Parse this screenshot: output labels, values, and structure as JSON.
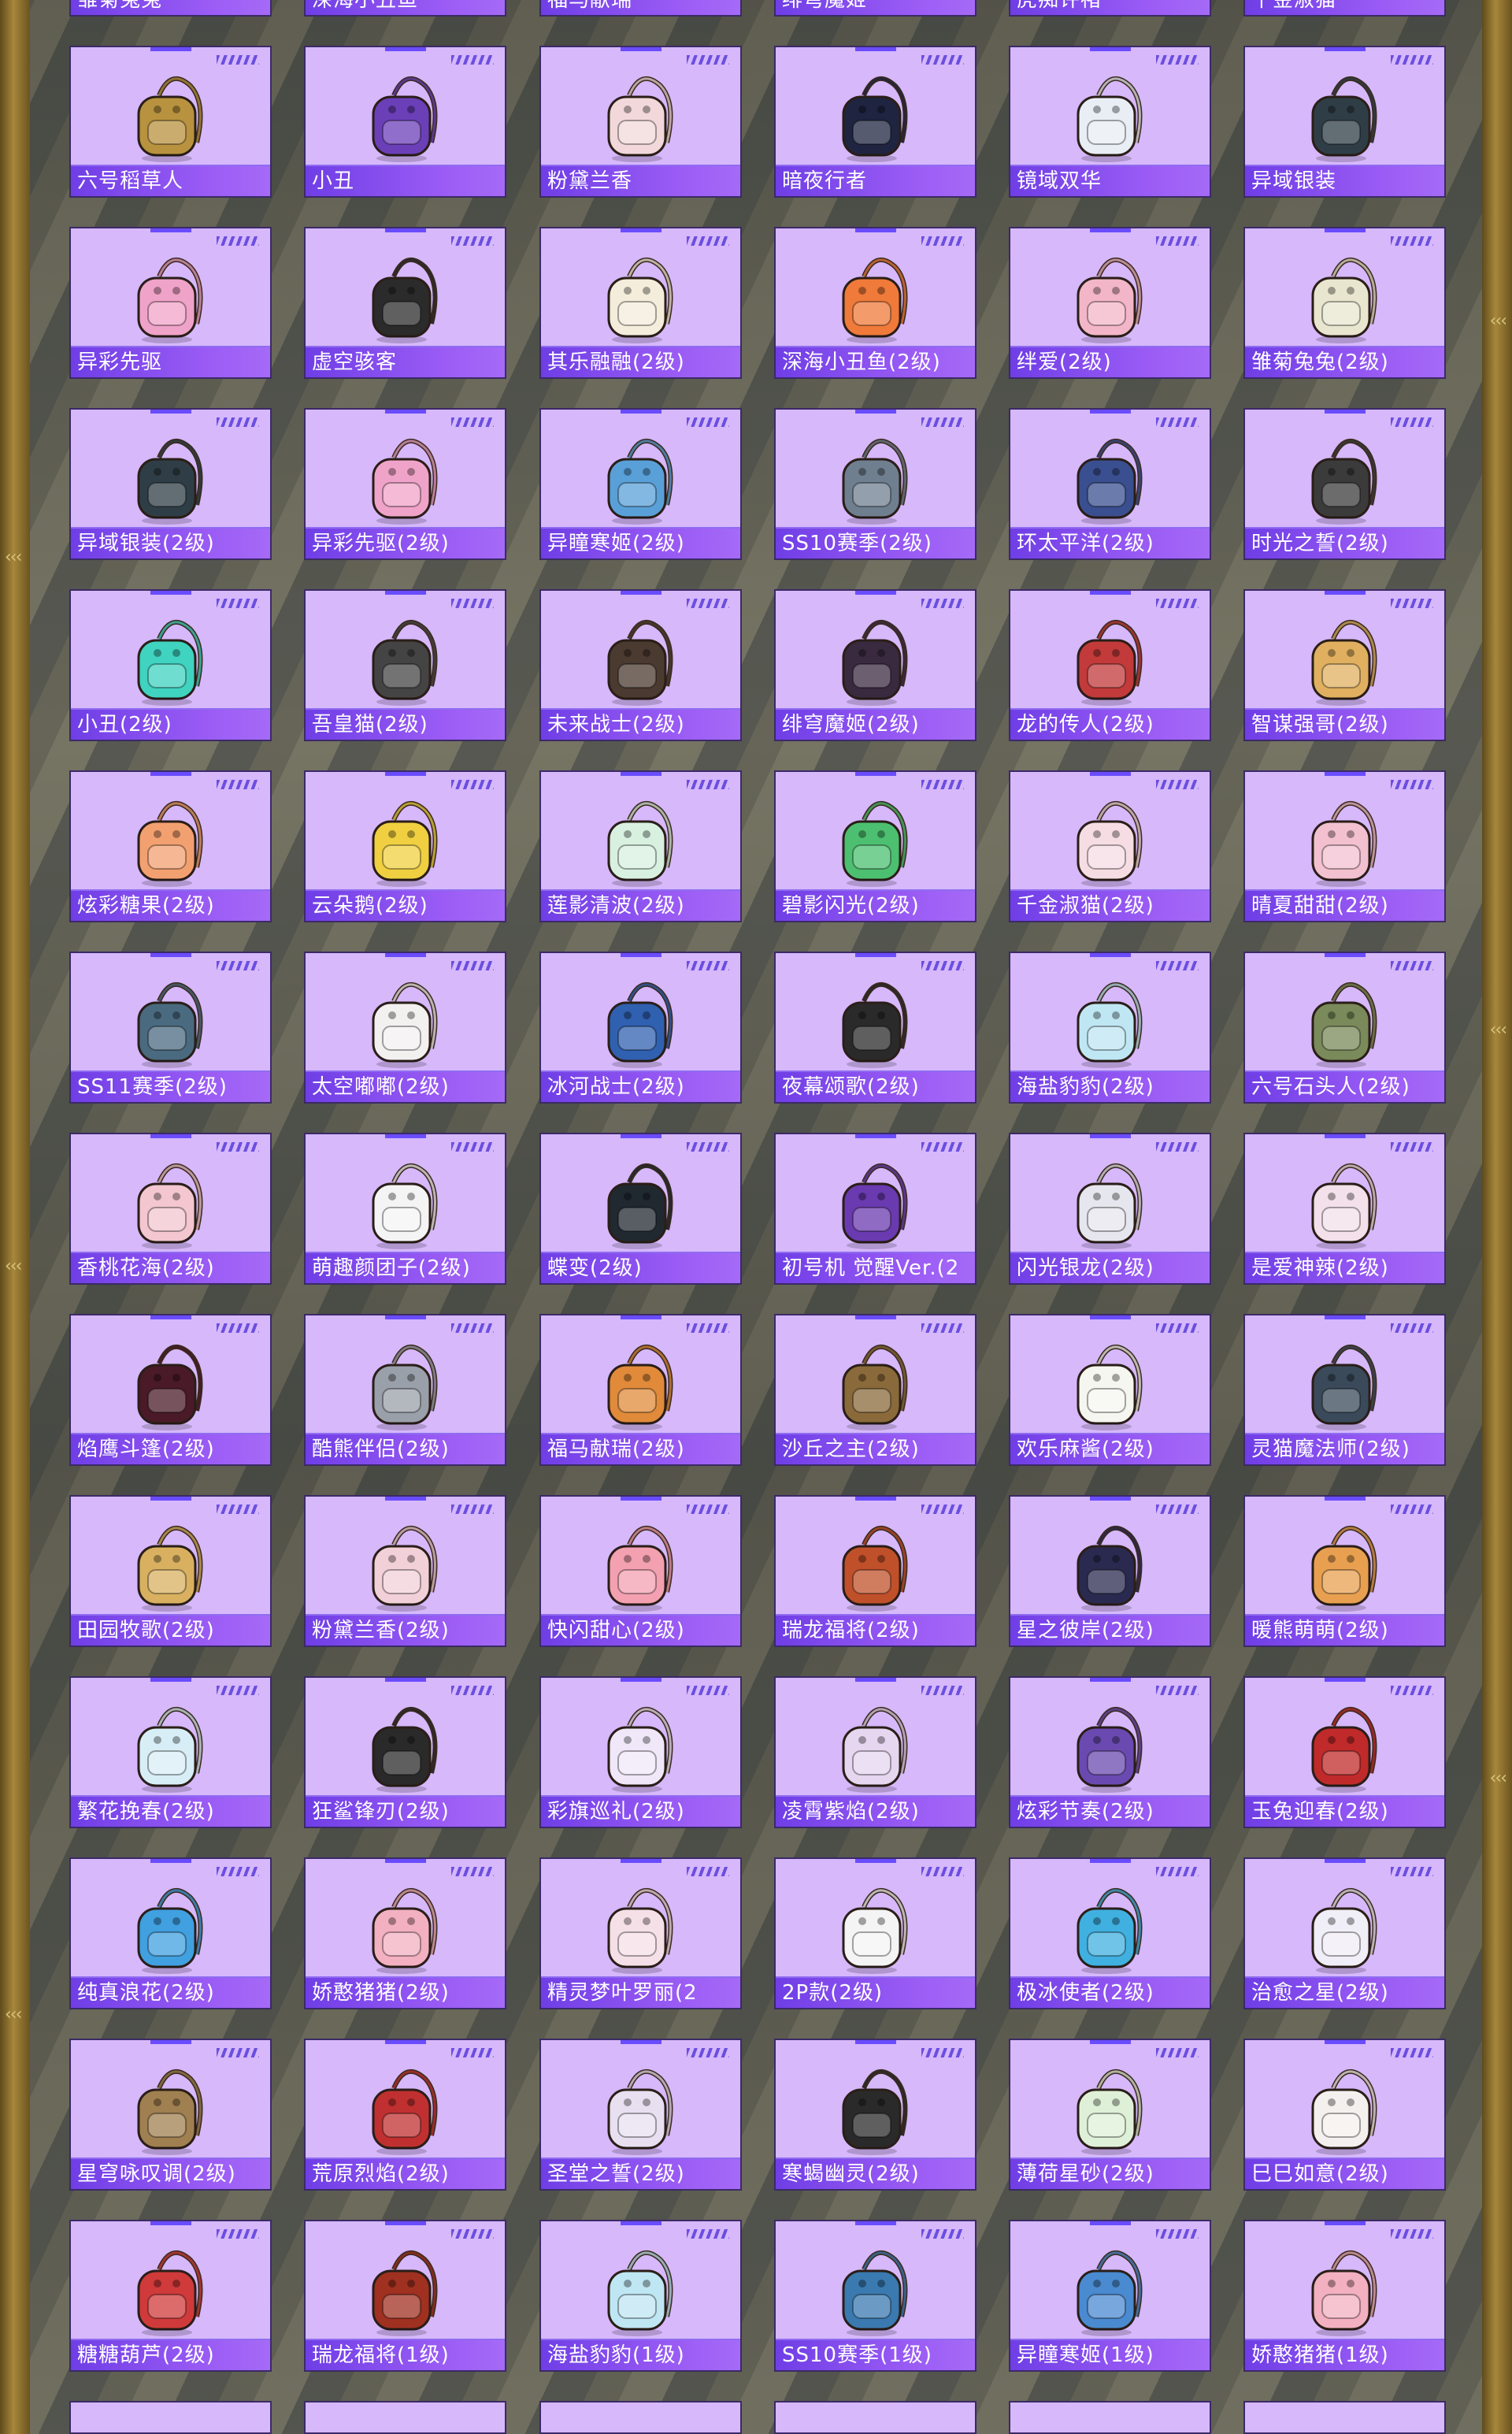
{
  "colors": {
    "card_bg": "#d6b8fb",
    "label_bar": "#7a44ec",
    "frame_gold": "#a7873a"
  },
  "rows": [
    {
      "items": [
        {
          "name": "雏菊兔兔",
          "icon": "backpack-icon",
          "color": "#e7d9b7"
        },
        {
          "name": "深海小丑鱼",
          "icon": "backpack-icon",
          "color": "#f07a3a"
        },
        {
          "name": "福马献瑞",
          "icon": "backpack-icon",
          "color": "#e08a4a"
        },
        {
          "name": "绯穹魔姬",
          "icon": "backpack-icon",
          "color": "#2a2a40"
        },
        {
          "name": "虎痴许褚",
          "icon": "backpack-icon",
          "color": "#c7a454"
        },
        {
          "name": "千金淑猫",
          "icon": "backpack-icon",
          "color": "#f4d3e0"
        }
      ]
    },
    {
      "items": [
        {
          "name": "六号稻草人",
          "icon": "backpack-icon",
          "color": "#b8923e"
        },
        {
          "name": "小丑",
          "icon": "backpack-icon",
          "color": "#6b3fb8"
        },
        {
          "name": "粉黛兰香",
          "icon": "backpack-icon",
          "color": "#f2d8da"
        },
        {
          "name": "暗夜行者",
          "icon": "backpack-icon",
          "color": "#1f2440"
        },
        {
          "name": "镜域双华",
          "icon": "backpack-icon",
          "color": "#e9eef5"
        },
        {
          "name": "异域银装",
          "icon": "backpack-icon",
          "color": "#2f3e46"
        }
      ]
    },
    {
      "items": [
        {
          "name": "异彩先驱",
          "icon": "backpack-icon",
          "color": "#f0a3c8"
        },
        {
          "name": "虚空骇客",
          "icon": "backpack-icon",
          "color": "#2b2b2b"
        },
        {
          "name": "其乐融融(2级)",
          "icon": "backpack-icon",
          "color": "#f5eddc"
        },
        {
          "name": "深海小丑鱼(2级)",
          "icon": "backpack-icon",
          "color": "#f07a3a"
        },
        {
          "name": "绊爱(2级)",
          "icon": "backpack-icon",
          "color": "#f3b6c8"
        },
        {
          "name": "雏菊兔兔(2级)",
          "icon": "backpack-icon",
          "color": "#e9e6cf"
        }
      ]
    },
    {
      "items": [
        {
          "name": "异域银装(2级)",
          "icon": "backpack-icon",
          "color": "#2f3e46"
        },
        {
          "name": "异彩先驱(2级)",
          "icon": "backpack-icon",
          "color": "#f0a3c8"
        },
        {
          "name": "异瞳寒姬(2级)",
          "icon": "backpack-icon",
          "color": "#5aa0d8"
        },
        {
          "name": "SS10赛季(2级)",
          "icon": "backpack-icon",
          "color": "#6f7f90"
        },
        {
          "name": "环太平洋(2级)",
          "icon": "backpack-icon",
          "color": "#3a4f90"
        },
        {
          "name": "时光之誓(2级)",
          "icon": "backpack-icon",
          "color": "#3b3b3b"
        }
      ]
    },
    {
      "items": [
        {
          "name": "小丑(2级)",
          "icon": "backpack-icon",
          "color": "#3fd3c0"
        },
        {
          "name": "吾皇猫(2级)",
          "icon": "backpack-icon",
          "color": "#444444"
        },
        {
          "name": "未来战士(2级)",
          "icon": "backpack-icon",
          "color": "#4a3a30"
        },
        {
          "name": "绯穹魔姬(2级)",
          "icon": "backpack-icon",
          "color": "#3a2a40"
        },
        {
          "name": "龙的传人(2级)",
          "icon": "backpack-icon",
          "color": "#c23a3a"
        },
        {
          "name": "智谋强哥(2级)",
          "icon": "backpack-icon",
          "color": "#e0b060"
        }
      ]
    },
    {
      "items": [
        {
          "name": "炫彩糖果(2级)",
          "icon": "backpack-icon",
          "color": "#f3a070"
        },
        {
          "name": "云朵鹅(2级)",
          "icon": "backpack-icon",
          "color": "#f0d040"
        },
        {
          "name": "莲影清波(2级)",
          "icon": "backpack-icon",
          "color": "#d8f0e0"
        },
        {
          "name": "碧影闪光(2级)",
          "icon": "backpack-icon",
          "color": "#4cc070"
        },
        {
          "name": "千金淑猫(2级)",
          "icon": "backpack-icon",
          "color": "#f6dde4"
        },
        {
          "name": "晴夏甜甜(2级)",
          "icon": "backpack-icon",
          "color": "#f3c0d0"
        }
      ]
    },
    {
      "items": [
        {
          "name": "SS11赛季(2级)",
          "icon": "backpack-icon",
          "color": "#4a6a80"
        },
        {
          "name": "太空嘟嘟(2级)",
          "icon": "backpack-icon",
          "color": "#f3f0f0"
        },
        {
          "name": "冰河战士(2级)",
          "icon": "backpack-icon",
          "color": "#3060b0"
        },
        {
          "name": "夜幕颂歌(2级)",
          "icon": "backpack-icon",
          "color": "#2a2a2a"
        },
        {
          "name": "海盐豹豹(2级)",
          "icon": "backpack-icon",
          "color": "#bfe6f3"
        },
        {
          "name": "六号石头人(2级)",
          "icon": "backpack-icon",
          "color": "#7a8a5a"
        }
      ]
    },
    {
      "items": [
        {
          "name": "香桃花海(2级)",
          "icon": "backpack-icon",
          "color": "#f3c6d0"
        },
        {
          "name": "萌趣颜团子(2级)",
          "icon": "backpack-icon",
          "color": "#f4f4f4"
        },
        {
          "name": "蝶变(2级)",
          "icon": "backpack-icon",
          "color": "#202830"
        },
        {
          "name": "初号机 觉醒Ver.(2",
          "icon": "backpack-icon",
          "color": "#6a3ab0"
        },
        {
          "name": "闪光银龙(2级)",
          "icon": "backpack-icon",
          "color": "#e6e6ee"
        },
        {
          "name": "是爱神辣(2级)",
          "icon": "backpack-icon",
          "color": "#f3e0ea"
        }
      ]
    },
    {
      "items": [
        {
          "name": "焰鹰斗篷(2级)",
          "icon": "backpack-icon",
          "color": "#4a1a28"
        },
        {
          "name": "酷熊伴侣(2级)",
          "icon": "backpack-icon",
          "color": "#9aa0aa"
        },
        {
          "name": "福马献瑞(2级)",
          "icon": "backpack-icon",
          "color": "#e08a3a"
        },
        {
          "name": "沙丘之主(2级)",
          "icon": "backpack-icon",
          "color": "#8a6a3a"
        },
        {
          "name": "欢乐麻酱(2级)",
          "icon": "backpack-icon",
          "color": "#f6f6f0"
        },
        {
          "name": "灵猫魔法师(2级)",
          "icon": "backpack-icon",
          "color": "#3a4a5a"
        }
      ]
    },
    {
      "items": [
        {
          "name": "田园牧歌(2级)",
          "icon": "backpack-icon",
          "color": "#d8b060"
        },
        {
          "name": "粉黛兰香(2级)",
          "icon": "backpack-icon",
          "color": "#f2d0d8"
        },
        {
          "name": "快闪甜心(2级)",
          "icon": "backpack-icon",
          "color": "#f3a0b0"
        },
        {
          "name": "瑞龙福将(2级)",
          "icon": "backpack-icon",
          "color": "#c0502a"
        },
        {
          "name": "星之彼岸(2级)",
          "icon": "backpack-icon",
          "color": "#2a2a50"
        },
        {
          "name": "暖熊萌萌(2级)",
          "icon": "backpack-icon",
          "color": "#e8a050"
        }
      ]
    },
    {
      "items": [
        {
          "name": "繁花挽春(2级)",
          "icon": "backpack-icon",
          "color": "#d8eef6"
        },
        {
          "name": "狂鲨锋刃(2级)",
          "icon": "backpack-icon",
          "color": "#2a2a2a"
        },
        {
          "name": "彩旗巡礼(2级)",
          "icon": "backpack-icon",
          "color": "#f0e8f8"
        },
        {
          "name": "凌霄紫焰(2级)",
          "icon": "backpack-icon",
          "color": "#e6d6f0"
        },
        {
          "name": "炫彩节奏(2级)",
          "icon": "backpack-icon",
          "color": "#6a4ab0"
        },
        {
          "name": "玉兔迎春(2级)",
          "icon": "backpack-icon",
          "color": "#c02a2a"
        }
      ]
    },
    {
      "items": [
        {
          "name": "纯真浪花(2级)",
          "icon": "backpack-icon",
          "color": "#40a0e0"
        },
        {
          "name": "娇憨猪猪(2级)",
          "icon": "backpack-icon",
          "color": "#f3b0c0"
        },
        {
          "name": "精灵梦叶罗丽(2",
          "icon": "backpack-icon",
          "color": "#f6e0e8"
        },
        {
          "name": "2P款(2级)",
          "icon": "backpack-icon",
          "color": "#f4f4f4"
        },
        {
          "name": "极冰使者(2级)",
          "icon": "backpack-icon",
          "color": "#40b0e0"
        },
        {
          "name": "治愈之星(2级)",
          "icon": "backpack-icon",
          "color": "#f0eef6"
        }
      ]
    },
    {
      "items": [
        {
          "name": "星穹咏叹调(2级)",
          "icon": "backpack-icon",
          "color": "#a08050"
        },
        {
          "name": "荒原烈焰(2级)",
          "icon": "backpack-icon",
          "color": "#c03030"
        },
        {
          "name": "圣堂之誓(2级)",
          "icon": "backpack-icon",
          "color": "#e8e0f0"
        },
        {
          "name": "寒蝎幽灵(2级)",
          "icon": "backpack-icon",
          "color": "#2a2a2a"
        },
        {
          "name": "薄荷星砂(2级)",
          "icon": "backpack-icon",
          "color": "#dff0d8"
        },
        {
          "name": "巳巳如意(2级)",
          "icon": "backpack-icon",
          "color": "#f4f0ee"
        }
      ]
    },
    {
      "items": [
        {
          "name": "糖糖葫芦(2级)",
          "icon": "backpack-icon",
          "color": "#d03a3a"
        },
        {
          "name": "瑞龙福将(1级)",
          "icon": "backpack-icon",
          "color": "#a03020"
        },
        {
          "name": "海盐豹豹(1级)",
          "icon": "backpack-icon",
          "color": "#bfe6f3"
        },
        {
          "name": "SS10赛季(1级)",
          "icon": "backpack-icon",
          "color": "#3a7ab0"
        },
        {
          "name": "异瞳寒姬(1级)",
          "icon": "backpack-icon",
          "color": "#4a8ad0"
        },
        {
          "name": "娇憨猪猪(1级)",
          "icon": "backpack-icon",
          "color": "#f3b0c0"
        }
      ]
    }
  ]
}
